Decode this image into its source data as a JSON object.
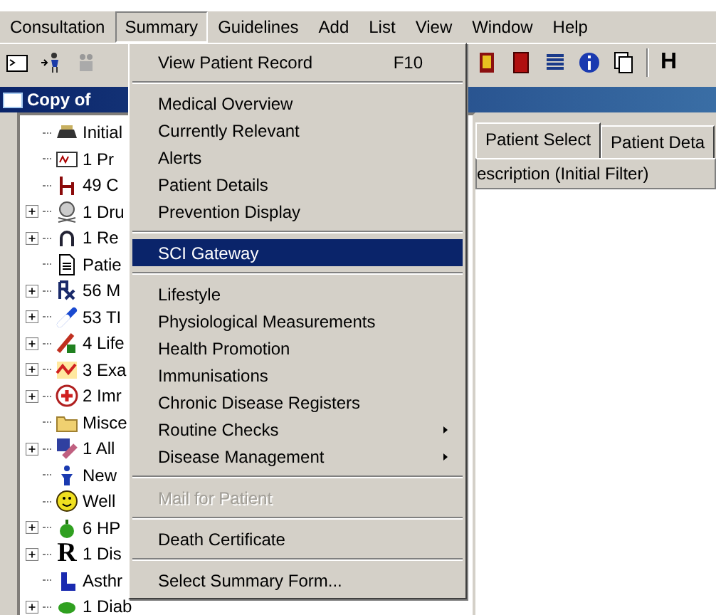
{
  "menu_bar": [
    {
      "label": "Consultation",
      "selected": false
    },
    {
      "label": "Summary",
      "selected": true
    },
    {
      "label": "Guidelines",
      "selected": false
    },
    {
      "label": "Add",
      "selected": false
    },
    {
      "label": "List",
      "selected": false
    },
    {
      "label": "View",
      "selected": false
    },
    {
      "label": "Window",
      "selected": false
    },
    {
      "label": "Help",
      "selected": false
    }
  ],
  "toolbar": {
    "trailing_text": "H"
  },
  "window": {
    "title": "Copy of"
  },
  "tree": [
    {
      "label": "Initial"
    },
    {
      "label": "1 Pr"
    },
    {
      "label": "49 C"
    },
    {
      "label": "1 Dru",
      "expanded": false
    },
    {
      "label": "1 Re",
      "expanded": false
    },
    {
      "label": "Patie"
    },
    {
      "label": "56 M",
      "expanded": false
    },
    {
      "label": "53 TI",
      "expanded": false
    },
    {
      "label": "4 Life",
      "expanded": false
    },
    {
      "label": "3 Exa",
      "expanded": false
    },
    {
      "label": "2 Imr",
      "expanded": false
    },
    {
      "label": "Misce"
    },
    {
      "label": "1 All",
      "expanded": false
    },
    {
      "label": "New"
    },
    {
      "label": "Well"
    },
    {
      "label": "6 HP",
      "expanded": false
    },
    {
      "label": "1 Dis",
      "expanded": false,
      "icon_text": "R"
    },
    {
      "label": "Asthr"
    },
    {
      "label": "1 Diab",
      "expanded": false
    }
  ],
  "tabs": [
    {
      "label": "Patient Select",
      "selected": true
    },
    {
      "label": "Patient Deta",
      "selected": false
    }
  ],
  "column_header": "escription (Initial Filter)",
  "summary_menu": [
    {
      "kind": "item",
      "label": "View Patient Record",
      "shortcut": "F10",
      "selected": false
    },
    {
      "kind": "separator"
    },
    {
      "kind": "item",
      "label": "Medical Overview",
      "selected": false
    },
    {
      "kind": "item",
      "label": "Currently Relevant",
      "selected": false
    },
    {
      "kind": "item",
      "label": "Alerts",
      "selected": false
    },
    {
      "kind": "item",
      "label": "Patient Details",
      "selected": false
    },
    {
      "kind": "item",
      "label": "Prevention Display",
      "selected": false
    },
    {
      "kind": "separator"
    },
    {
      "kind": "item",
      "label": "SCI Gateway",
      "selected": true
    },
    {
      "kind": "separator"
    },
    {
      "kind": "item",
      "label": "Lifestyle",
      "selected": false
    },
    {
      "kind": "item",
      "label": "Physiological Measurements",
      "selected": false
    },
    {
      "kind": "item",
      "label": "Health Promotion",
      "selected": false
    },
    {
      "kind": "item",
      "label": "Immunisations",
      "selected": false
    },
    {
      "kind": "item",
      "label": "Chronic Disease Registers",
      "selected": false
    },
    {
      "kind": "item",
      "label": "Routine Checks",
      "submenu": true,
      "selected": false
    },
    {
      "kind": "item",
      "label": "Disease Management",
      "submenu": true,
      "selected": false
    },
    {
      "kind": "separator"
    },
    {
      "kind": "item",
      "label": "Mail for Patient",
      "disabled": true,
      "selected": false
    },
    {
      "kind": "separator"
    },
    {
      "kind": "item",
      "label": "Death Certificate",
      "selected": false
    },
    {
      "kind": "separator"
    },
    {
      "kind": "item",
      "label": "Select Summary Form...",
      "selected": false
    }
  ]
}
